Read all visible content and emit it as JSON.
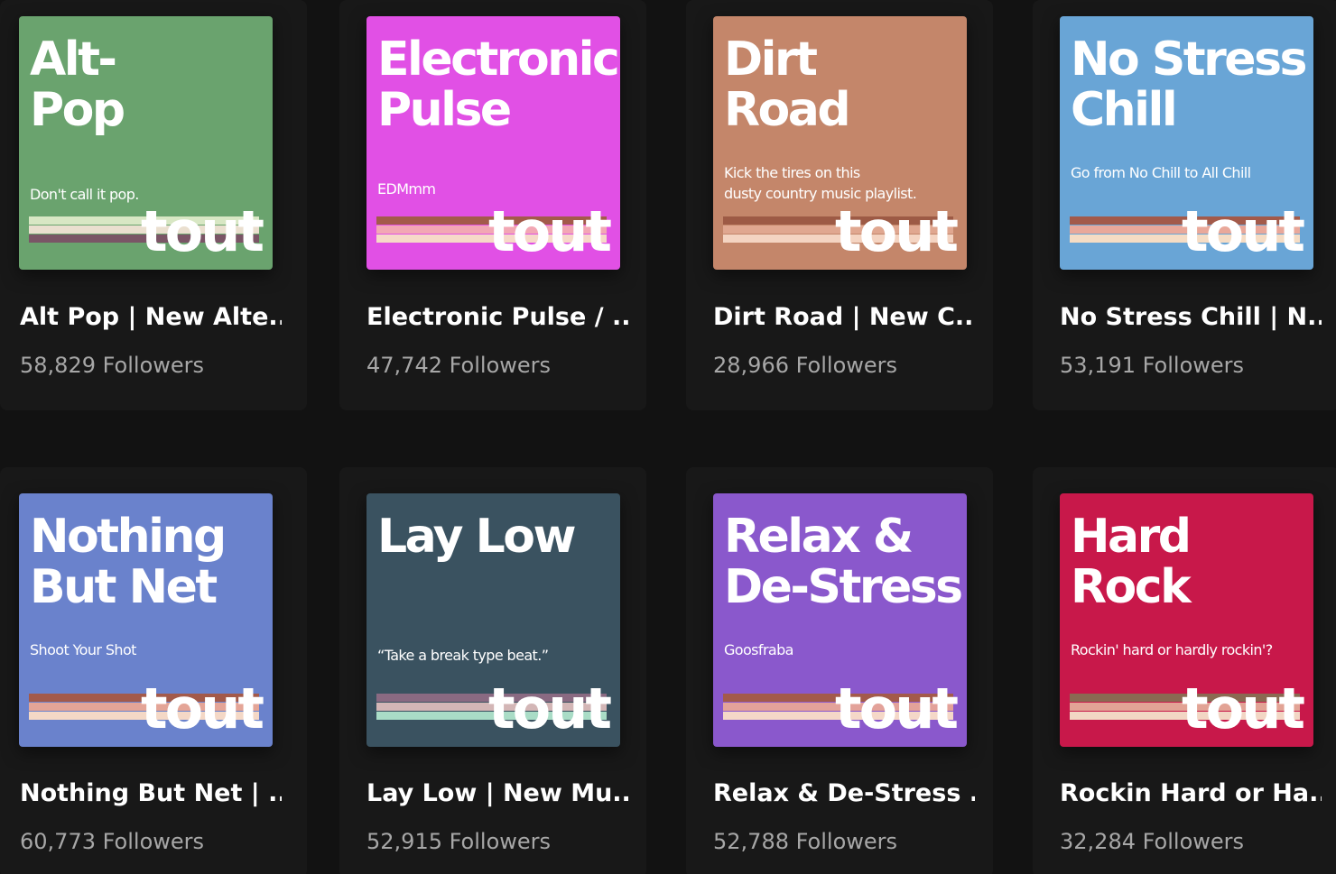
{
  "colors": {
    "page_background": "#121212",
    "card_background": "#181818",
    "title_text": "#ffffff",
    "followers_text": "#a7a7a7"
  },
  "playlists": [
    {
      "cover_title": "Alt-\nPop",
      "cover_subtitle": "Don't call it pop.",
      "cover_brand": "tout",
      "cover_color": "#6aa36e",
      "stripe_colors": [
        "#d8e7c4",
        "#eadfcf",
        "#7a5566"
      ],
      "title": "Alt Pop | New Alte...",
      "followers": "58,829 Followers"
    },
    {
      "cover_title": "Electronic\nPulse",
      "cover_subtitle": "EDMmm",
      "cover_brand": "tout",
      "cover_color": "#e150e5",
      "stripe_colors": [
        "#a35a4a",
        "#f2a7b4",
        "#f6d9c8"
      ],
      "title": "Electronic Pulse / ...",
      "followers": "47,742 Followers"
    },
    {
      "cover_title": "Dirt\nRoad",
      "cover_subtitle": "Kick the tires on this\ndusty country music playlist.",
      "cover_brand": "tout",
      "cover_color": "#c4866a",
      "stripe_colors": [
        "#9d5a45",
        "#e0a790",
        "#f4d4c2"
      ],
      "title": "Dirt Road | New C...",
      "followers": "28,966 Followers"
    },
    {
      "cover_title": "No Stress\nChill",
      "cover_subtitle": "Go from No Chill to All Chill",
      "cover_brand": "tout",
      "cover_color": "#69a5d6",
      "stripe_colors": [
        "#a35a4a",
        "#e9a89a",
        "#f5dcc4"
      ],
      "title": "No Stress Chill | N...",
      "followers": "53,191 Followers"
    },
    {
      "cover_title": "Nothing\nBut Net",
      "cover_subtitle": "Shoot Your Shot",
      "cover_brand": "tout",
      "cover_color": "#6a82cc",
      "stripe_colors": [
        "#a35a4a",
        "#e4a597",
        "#f4d8c6"
      ],
      "title": "Nothing But Net | ...",
      "followers": "60,773 Followers"
    },
    {
      "cover_title": "Lay Low",
      "cover_subtitle": "“Take a break type beat.”",
      "cover_brand": "tout",
      "cover_color": "#3a5260",
      "stripe_colors": [
        "#8a6a82",
        "#d3b6b6",
        "#a9dcc6"
      ],
      "title": "Lay Low | New Mu...",
      "followers": "52,915 Followers"
    },
    {
      "cover_title": "Relax &\nDe-Stress",
      "cover_subtitle": "Goosfraba",
      "cover_brand": "tout",
      "cover_color": "#8a58cc",
      "stripe_colors": [
        "#a35a4a",
        "#e3a29a",
        "#f5d8c8"
      ],
      "title": "Relax & De-Stress ...",
      "followers": "52,788 Followers"
    },
    {
      "cover_title": "Hard\nRock",
      "cover_subtitle": "Rockin' hard or hardly rockin'?",
      "cover_brand": "tout",
      "cover_color": "#c8184a",
      "stripe_colors": [
        "#8a6a52",
        "#e2a395",
        "#f2d6c4"
      ],
      "title": "Rockin Hard or Ha...",
      "followers": "32,284 Followers"
    }
  ]
}
